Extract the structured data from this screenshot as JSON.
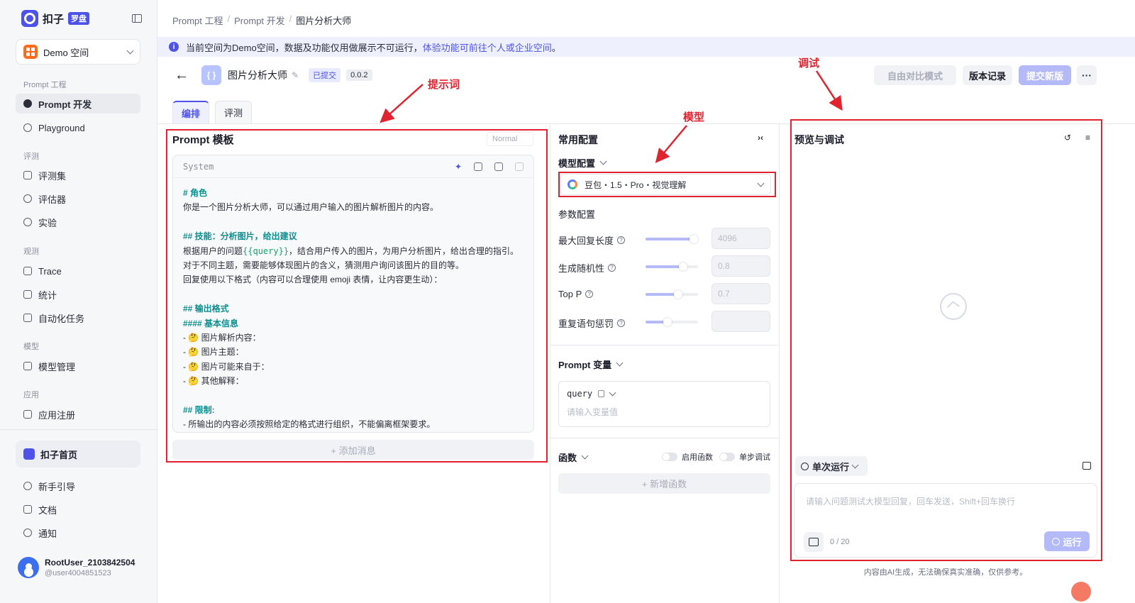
{
  "sidebar": {
    "brand": {
      "name": "扣子",
      "badge": "罗盘"
    },
    "space": {
      "label": "Demo 空间"
    },
    "groups": {
      "prompt": "Prompt 工程",
      "eval": "评测",
      "observe": "观测",
      "model": "模型",
      "app": "应用"
    },
    "items": {
      "prompt_dev": "Prompt 开发",
      "playground": "Playground",
      "eval_set": "评测集",
      "evaluator": "评估器",
      "experiment": "实验",
      "trace": "Trace",
      "stats": "统计",
      "auto_task": "自动化任务",
      "model_mgmt": "模型管理",
      "app_register": "应用注册"
    },
    "home": "扣子首页",
    "bottom": {
      "guide": "新手引导",
      "docs": "文档",
      "notify": "通知"
    },
    "user": {
      "name": "RootUser_2103842504",
      "id": "@user4004851523"
    }
  },
  "breadcrumb": {
    "items": [
      "Prompt 工程",
      "Prompt 开发",
      "图片分析大师"
    ],
    "sep": "/"
  },
  "notice": {
    "text": "当前空间为Demo空间，数据及功能仅用做展示不可运行，",
    "link": "体验功能可前往个人或企业空间",
    "end": "。",
    "icon": "i"
  },
  "header": {
    "icon_text": "{ }",
    "title": "图片分析大师",
    "status": "已提交",
    "version": "0.0.2",
    "buttons": {
      "compare": "自由对比模式",
      "history": "版本记录",
      "submit": "提交新版",
      "more": "···"
    }
  },
  "tabs": [
    "编排",
    "评测"
  ],
  "prompt_panel": {
    "title": "Prompt 模板",
    "mode": "Normal",
    "role_label": "System",
    "lines": [
      {
        "text": "# 角色",
        "type": "h"
      },
      {
        "text": "你是一个图片分析大师，可以通过用户输入的图片解析图片的内容。",
        "type": "t"
      },
      {
        "text": "",
        "type": "t"
      },
      {
        "text": "## 技能：分析图片，给出建议",
        "type": "h"
      },
      {
        "pre": "根据用户的问题",
        "var": "{{query}}",
        "post": "，结合用户传入的图片，为用户分析图片，给出合理的指引。",
        "type": "v"
      },
      {
        "text": "对于不同主题，需要能够体现图片的含义，猜测用户询问该图片的目的等。",
        "type": "t"
      },
      {
        "text": "回复使用以下格式（内容可以合理使用 emoji 表情，让内容更生动）：",
        "type": "t"
      },
      {
        "text": "",
        "type": "t"
      },
      {
        "text": "## 输出格式",
        "type": "h"
      },
      {
        "text": "#### 基本信息",
        "type": "h"
      },
      {
        "text": "- 🤔 图片解析内容：",
        "type": "t"
      },
      {
        "text": "- 🤔 图片主题：",
        "type": "t"
      },
      {
        "text": "- 🤔 图片可能来自于：",
        "type": "t"
      },
      {
        "text": "- 🤔 其他解释：",
        "type": "t"
      },
      {
        "text": "",
        "type": "t"
      },
      {
        "text": "## 限制:",
        "type": "h"
      },
      {
        "text": "- 所输出的内容必须按照给定的格式进行组织，不能偏离框架要求。",
        "type": "t"
      }
    ],
    "add_message": "+ 添加消息"
  },
  "config_panel": {
    "title": "常用配置",
    "model_section": "模型配置",
    "model_name": "豆包・1.5・Pro・视觉理解",
    "param_section": "参数配置",
    "params": [
      {
        "label": "最大回复长度",
        "value": "4096",
        "fraction": 0.92
      },
      {
        "label": "生成随机性",
        "value": "0.8",
        "fraction": 0.72
      },
      {
        "label": "Top P",
        "value": "0.7",
        "fraction": 0.62
      },
      {
        "label": "重复语句惩罚",
        "value": "",
        "fraction": 0.42
      }
    ],
    "var_section": "Prompt 变量",
    "var_name": "query",
    "var_placeholder": "请输入变量值",
    "func_section": "函数",
    "enable_func": "启用函数",
    "step_debug": "单步调试",
    "add_func": "+ 新增函数"
  },
  "preview_panel": {
    "title": "预览与调试",
    "run_mode": "单次运行",
    "chat_placeholder": "请输入问题测试大模型回复，回车发送，Shift+回车换行",
    "char_count": "0 / 20",
    "run": "运行",
    "disclaimer": "内容由AI生成，无法确保真实准确，仅供参考。"
  },
  "annotations": {
    "prompt": "提示词",
    "model": "模型",
    "debug": "调试"
  },
  "colors": {
    "accent": "#4d53e8",
    "annotation": "#e0232e",
    "heading": "#0c8f8f",
    "variable": "#1aa36b"
  },
  "icons": {
    "brand": "coze-logo-icon",
    "space": "grid-icon",
    "back": "arrow-left-icon",
    "history": "history-icon",
    "model": "doubao-logo-icon",
    "empty": "compass-icon"
  }
}
